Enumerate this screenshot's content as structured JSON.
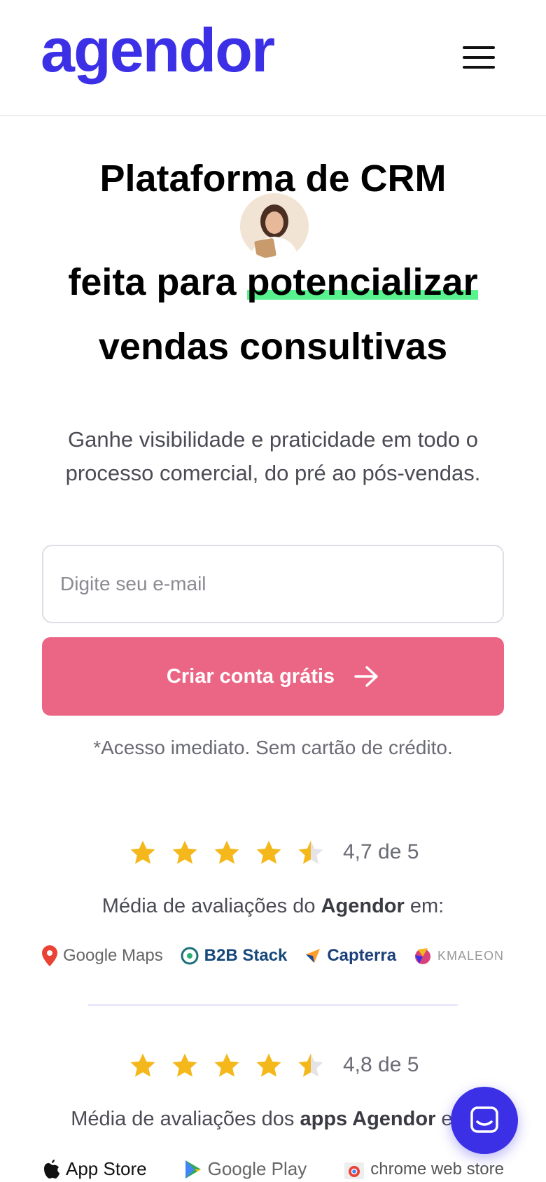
{
  "header": {
    "logo_text": "agendor",
    "menu_icon": "hamburger-menu-icon"
  },
  "hero": {
    "title_line1": "Plataforma de CRM",
    "title_line2_prefix": "feita para ",
    "title_line2_highlight": "potencializar",
    "title_line3": "vendas consultivas",
    "subtitle": "Ganhe visibilidade e praticidade em todo o processo comercial, do pré ao pós-vendas."
  },
  "signup": {
    "email_placeholder": "Digite seu e-mail",
    "email_value": "",
    "cta_label": "Criar conta grátis",
    "note": "*Acesso imediato. Sem cartão de crédito."
  },
  "reviews": {
    "rating": 4.7,
    "rating_text": "4,7 de 5",
    "caption_prefix": "Média de avaliações do ",
    "caption_bold": "Agendor",
    "caption_suffix": " em:",
    "platforms": [
      "Google Maps",
      "B2B Stack",
      "Capterra",
      "KMALEON"
    ]
  },
  "app_reviews": {
    "rating": 4.8,
    "rating_text": "4,8 de 5",
    "caption_prefix": "Média de avaliações dos ",
    "caption_bold": "apps Agendor",
    "caption_suffix": " em:",
    "platforms": [
      "App Store",
      "Google Play",
      "chrome web store"
    ]
  },
  "colors": {
    "brand": "#3b30e6",
    "cta": "#ea6684",
    "highlight": "#58f28f",
    "star": "#f5b81c"
  },
  "chat": {
    "icon": "chat-bubble-icon"
  }
}
